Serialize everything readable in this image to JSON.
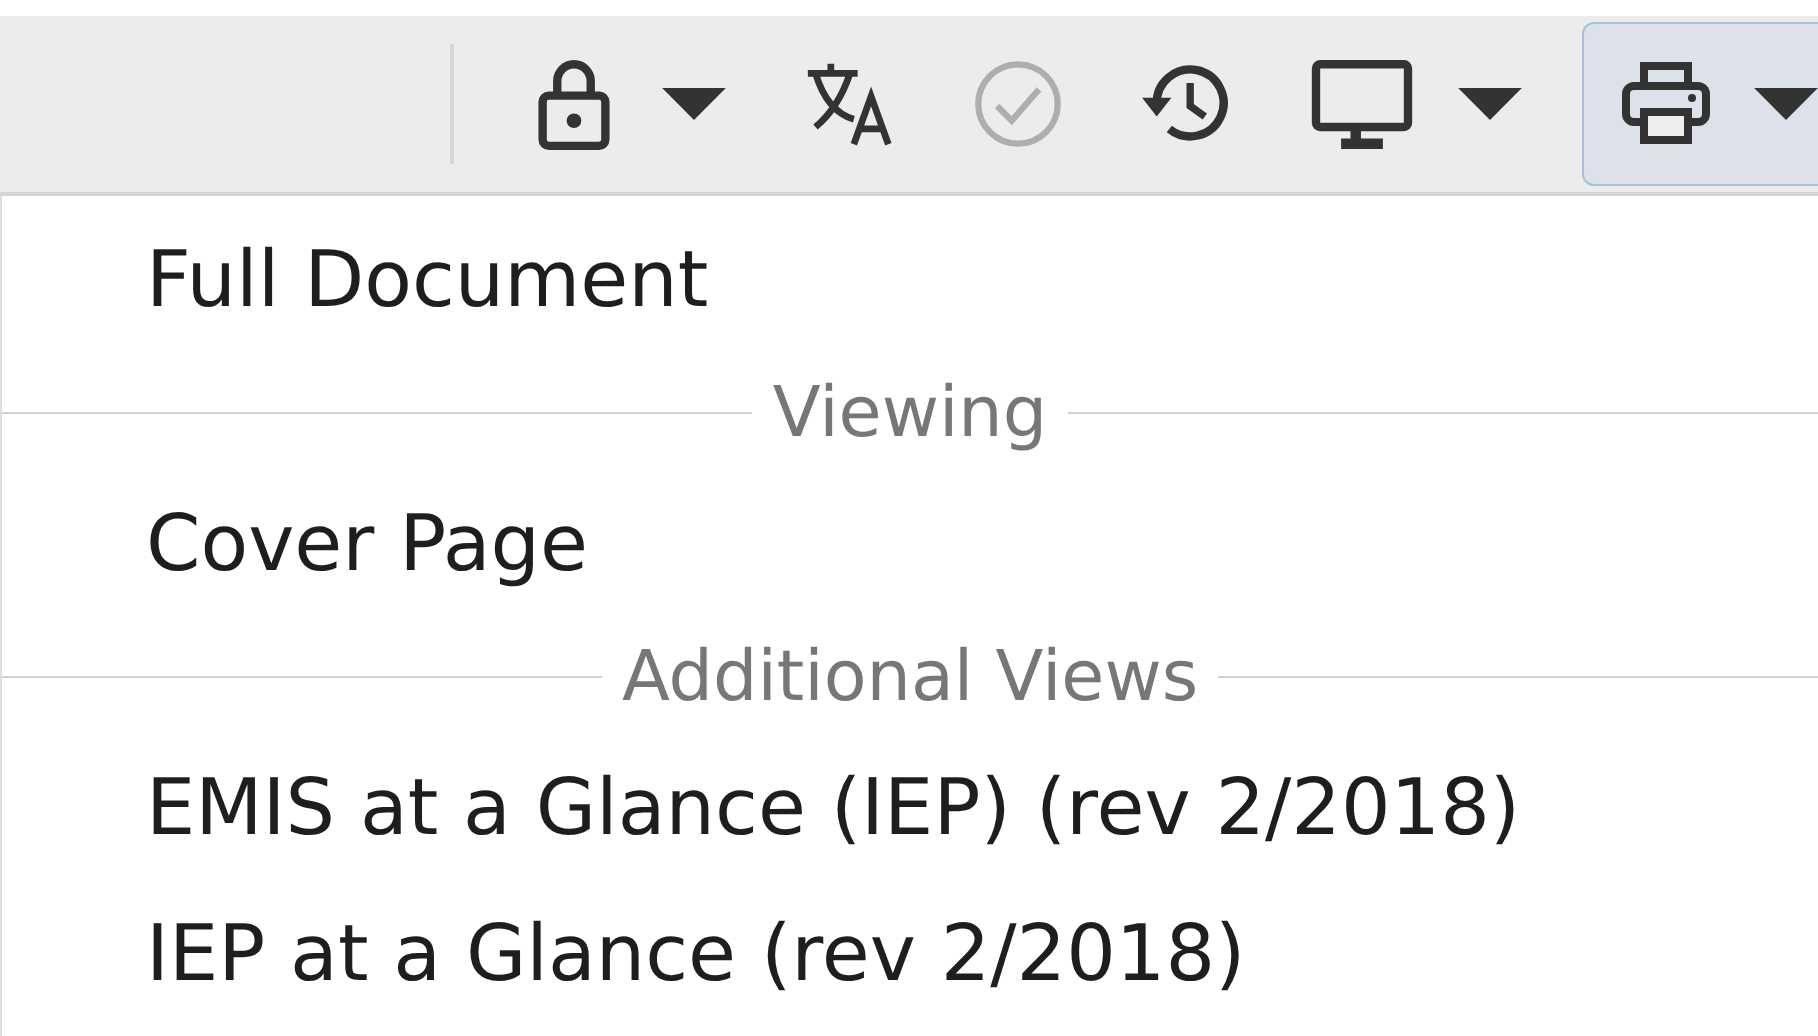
{
  "toolbar": [
    {
      "kind": "lock",
      "dropdown": true,
      "disabled": false,
      "selected": false
    },
    {
      "kind": "translate",
      "dropdown": false,
      "disabled": false,
      "selected": false
    },
    {
      "kind": "check",
      "dropdown": false,
      "disabled": true,
      "selected": false
    },
    {
      "kind": "history",
      "dropdown": false,
      "disabled": false,
      "selected": false
    },
    {
      "kind": "monitor",
      "dropdown": true,
      "disabled": false,
      "selected": false
    },
    {
      "kind": "print",
      "dropdown": true,
      "disabled": false,
      "selected": true
    }
  ],
  "menu": [
    {
      "kind": "item",
      "label": "Full Document"
    },
    {
      "kind": "header",
      "label": "Viewing"
    },
    {
      "kind": "item",
      "label": "Cover Page"
    },
    {
      "kind": "header",
      "label": "Additional Views"
    },
    {
      "kind": "item",
      "label": "EMIS at a Glance (IEP) (rev 2/2018)"
    },
    {
      "kind": "item",
      "label": "IEP at a Glance (rev 2/2018)"
    }
  ]
}
